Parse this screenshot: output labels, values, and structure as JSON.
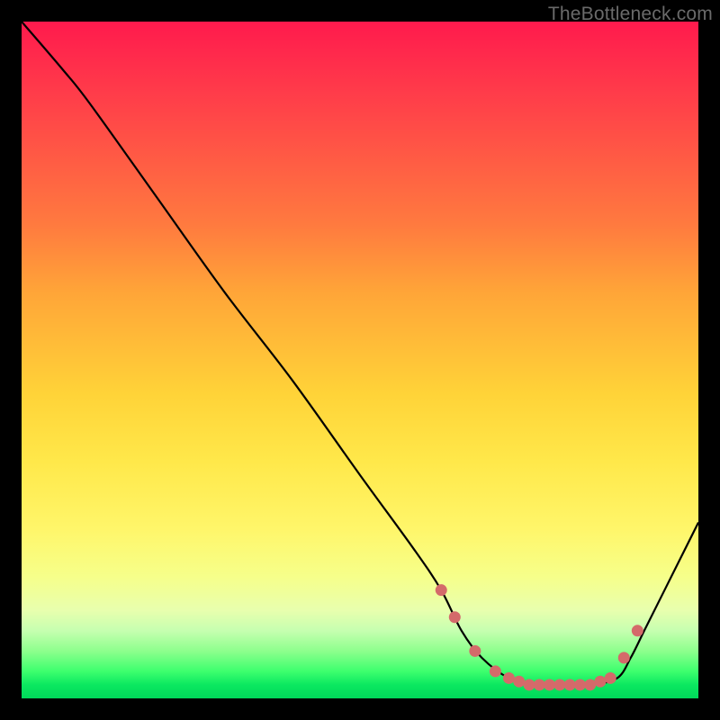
{
  "watermark": "TheBottleneck.com",
  "chart_data": {
    "type": "line",
    "title": "",
    "xlabel": "",
    "ylabel": "",
    "xlim": [
      0,
      100
    ],
    "ylim": [
      0,
      100
    ],
    "series": [
      {
        "name": "curve",
        "x": [
          0,
          6,
          10,
          20,
          30,
          40,
          50,
          58,
          62,
          65,
          68,
          72,
          76,
          80,
          84,
          88,
          90,
          92,
          95,
          100
        ],
        "y": [
          100,
          93,
          88,
          74,
          60,
          47,
          33,
          22,
          16,
          10,
          6,
          3,
          2,
          2,
          2,
          3,
          6,
          10,
          16,
          26
        ]
      }
    ],
    "markers": {
      "name": "dots",
      "x": [
        62,
        64,
        67,
        70,
        72,
        73.5,
        75,
        76.5,
        78,
        79.5,
        81,
        82.5,
        84,
        85.5,
        87,
        89,
        91
      ],
      "y": [
        16,
        12,
        7,
        4,
        3,
        2.5,
        2,
        2,
        2,
        2,
        2,
        2,
        2,
        2.5,
        3,
        6,
        10
      ]
    },
    "gradient_stops": [
      {
        "pos": 0,
        "color": "#ff1a4d"
      },
      {
        "pos": 30,
        "color": "#ff7a3f"
      },
      {
        "pos": 55,
        "color": "#ffd338"
      },
      {
        "pos": 82,
        "color": "#f6ff8a"
      },
      {
        "pos": 96,
        "color": "#3dff6e"
      },
      {
        "pos": 100,
        "color": "#00d85a"
      }
    ]
  }
}
